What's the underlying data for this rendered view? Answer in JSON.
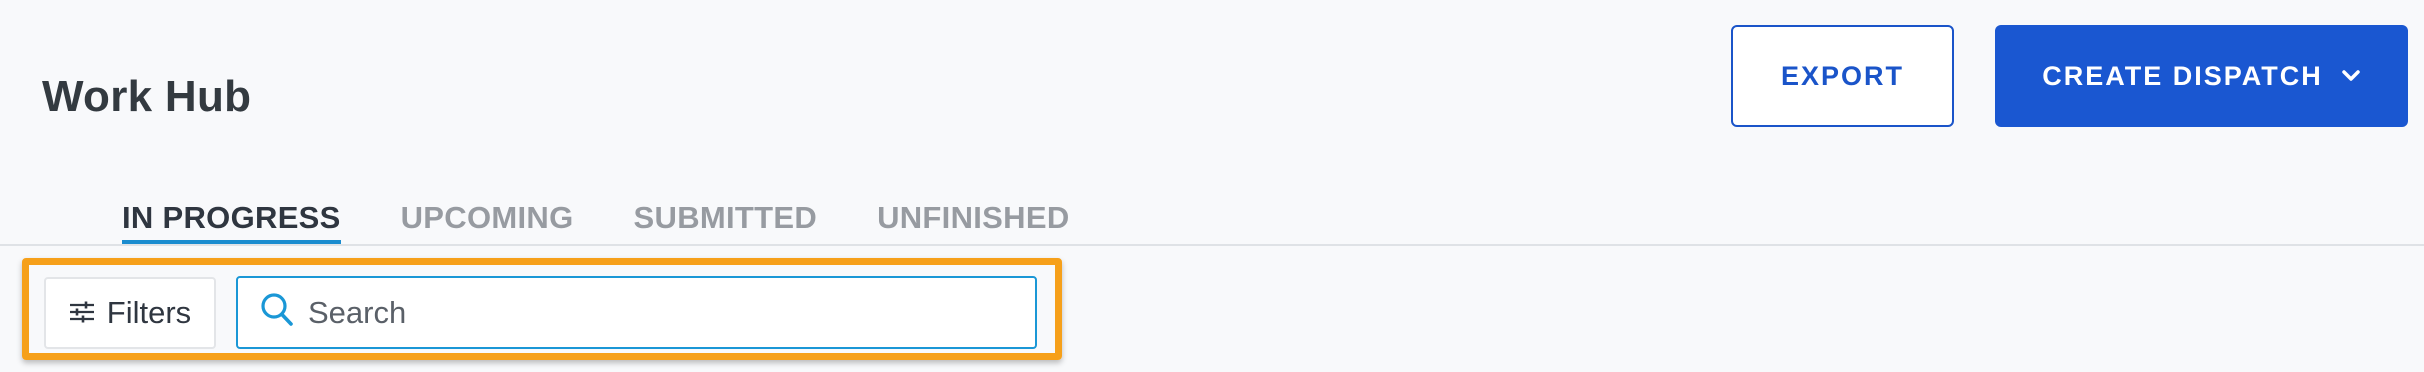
{
  "header": {
    "title": "Work Hub",
    "export_label": "EXPORT",
    "create_label": "CREATE DISPATCH"
  },
  "tabs": [
    {
      "label": "IN PROGRESS",
      "active": true
    },
    {
      "label": "UPCOMING",
      "active": false
    },
    {
      "label": "SUBMITTED",
      "active": false
    },
    {
      "label": "UNFINISHED",
      "active": false
    }
  ],
  "toolbar": {
    "filters_label": "Filters",
    "search_placeholder": "Search",
    "search_value": ""
  },
  "colors": {
    "primary": "#1a57d1",
    "active_tab_underline": "#1a8ccf",
    "highlight_border": "#f6a01a",
    "search_border": "#1a97d6",
    "background": "#f8f9fb"
  },
  "icons": {
    "create_chevron": "chevron-down-icon",
    "filters": "sliders-icon",
    "search": "search-icon"
  }
}
